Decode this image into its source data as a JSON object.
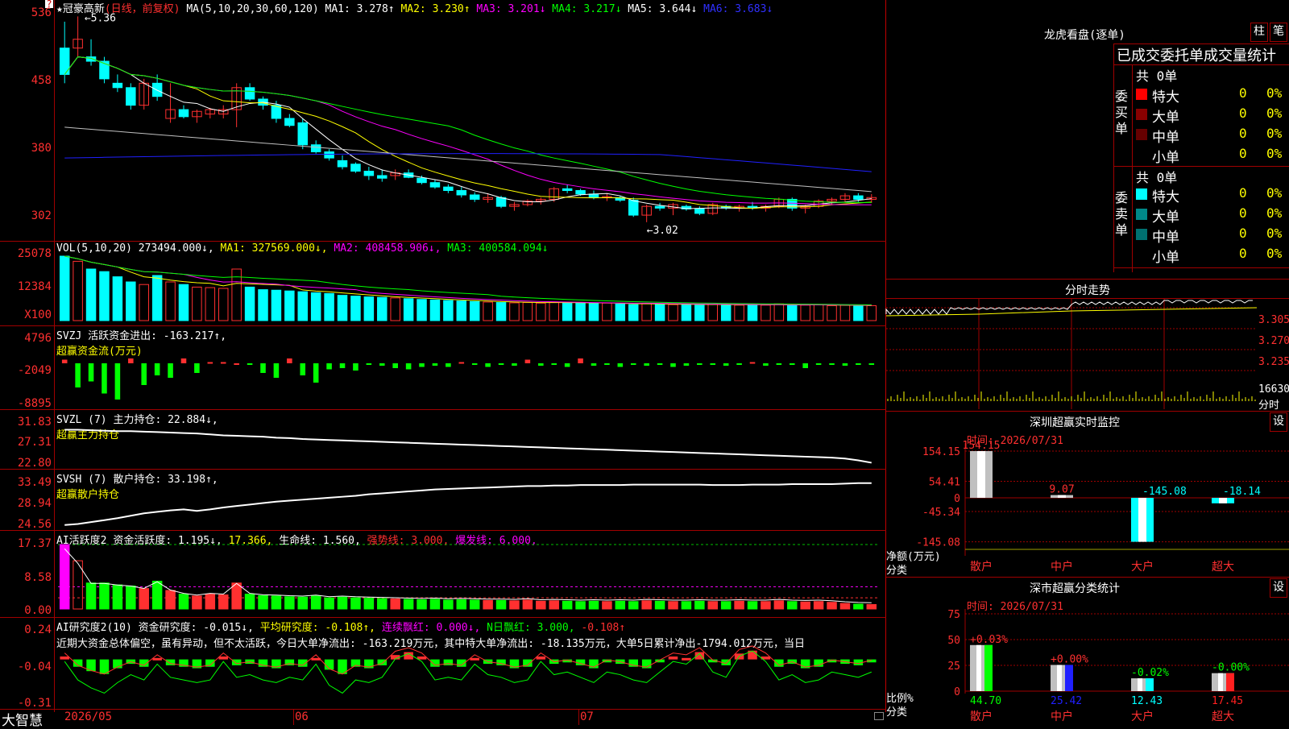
{
  "colors": {
    "up": "#ff3030",
    "down": "#00ffff",
    "bg": "#000000",
    "grid": "#a00000",
    "ma1": "#ffffff",
    "ma2": "#ffff00",
    "ma3": "#ff00ff",
    "ma4": "#00ff00",
    "ma5": "#c0c0c0",
    "ma6": "#2020ff"
  },
  "stock": {
    "star": "★",
    "name": "冠豪高新",
    "mode": "(日线，前复权)",
    "ma_label": "MA(5,10,20,30,60,120)",
    "ma1": "MA1: 3.278↑",
    "ma2": "MA2: 3.230↑",
    "ma3": "MA3: 3.201↓",
    "ma4": "MA4: 3.217↓",
    "ma5": "MA5: 3.644↓",
    "ma6": "MA6: 3.683↓",
    "hi_mark": "5.36",
    "lo_mark": "3.02",
    "corner": "?"
  },
  "y_axis": {
    "price": [
      "536",
      "458",
      "380",
      "302"
    ],
    "vol": [
      "25078",
      "12384",
      "X100"
    ],
    "svzj": [
      "4796",
      "-2049",
      "-8895"
    ],
    "svzl": [
      "31.83",
      "27.31",
      "22.80"
    ],
    "svsh": [
      "33.49",
      "28.94",
      "24.56"
    ],
    "ai1": [
      "17.37",
      "8.58",
      "0.00"
    ],
    "ai2": [
      "0.24",
      "-0.04",
      "-0.31"
    ]
  },
  "panels": {
    "vol": {
      "label": "VOL(5,10,20)",
      "v0": "273494.000↓,",
      "ma1": "MA1: 327569.000↓,",
      "ma2": "MA2: 408458.906↓,",
      "ma3": "MA3: 400584.094↓"
    },
    "svzj": {
      "label": "SVZJ",
      "text": "活跃资金进出: -163.217↑,",
      "sub": "超赢资金流(万元)"
    },
    "svzl": {
      "label": "SVZL (7)",
      "text": "主力持仓: 22.884↓,",
      "sub": "超赢主力持仓"
    },
    "svsh": {
      "label": "SVSH (7)",
      "text": "散户持仓: 33.198↑,",
      "sub": "超赢散户持仓"
    },
    "ai1": {
      "label": "AI活跃度2",
      "t1": "资金活跃度: 1.195↓,",
      "t2": "17.366,",
      "t3": "生命线: 1.560,",
      "t4": "强势线: 3.000,",
      "t5": "爆发线: 6.000,"
    },
    "ai2": {
      "label": "AI研究度2(10)",
      "t1": "资金研究度: -0.015↓,",
      "t2": "平均研究度: -0.108↑,",
      "t3": "连续飘红: 0.000↓,",
      "t4": "N日飘红: 3.000,",
      "t5": "-0.108↑",
      "news": "近期大资金总体偏空，虽有异动，但不太活跃，今日大单净流出: -163.219万元，其中特大单净流出: -18.135万元，大单5日累计净出-1794.012万元，当日"
    }
  },
  "x_axis": {
    "brand": "大智慧",
    "d1": "2026/05",
    "d2": "06",
    "d3": "07"
  },
  "chart_data": [
    {
      "type": "candlestick",
      "title": "冠豪高新 (日线，前复权)",
      "ylim": [
        3.02,
        5.36
      ],
      "hi": 5.36,
      "lo": 3.02,
      "ohlc": [
        [
          5.0,
          5.3,
          4.6,
          4.7
        ],
        [
          5.0,
          5.36,
          4.9,
          5.1
        ],
        [
          4.9,
          5.1,
          4.8,
          4.85
        ],
        [
          4.85,
          4.9,
          4.6,
          4.65
        ],
        [
          4.6,
          4.7,
          4.5,
          4.55
        ],
        [
          4.55,
          4.6,
          4.3,
          4.35
        ],
        [
          4.35,
          4.65,
          4.3,
          4.6
        ],
        [
          4.6,
          4.7,
          4.4,
          4.45
        ],
        [
          4.2,
          4.6,
          4.15,
          4.3
        ],
        [
          4.3,
          4.35,
          4.2,
          4.22
        ],
        [
          4.22,
          4.3,
          4.15,
          4.28
        ],
        [
          4.25,
          4.32,
          4.2,
          4.3
        ],
        [
          4.25,
          4.35,
          4.2,
          4.3
        ],
        [
          4.3,
          4.6,
          4.1,
          4.55
        ],
        [
          4.55,
          4.6,
          4.4,
          4.42
        ],
        [
          4.42,
          4.45,
          4.3,
          4.35
        ],
        [
          4.35,
          4.4,
          4.15,
          4.2
        ],
        [
          4.2,
          4.25,
          4.1,
          4.12
        ],
        [
          4.15,
          4.2,
          3.85,
          3.9
        ],
        [
          3.9,
          3.95,
          3.8,
          3.82
        ],
        [
          3.82,
          3.85,
          3.72,
          3.75
        ],
        [
          3.72,
          3.78,
          3.62,
          3.65
        ],
        [
          3.68,
          3.7,
          3.58,
          3.6
        ],
        [
          3.6,
          3.65,
          3.5,
          3.55
        ],
        [
          3.55,
          3.62,
          3.48,
          3.52
        ],
        [
          3.55,
          3.62,
          3.5,
          3.58
        ],
        [
          3.58,
          3.62,
          3.52,
          3.53
        ],
        [
          3.52,
          3.55,
          3.45,
          3.47
        ],
        [
          3.47,
          3.5,
          3.4,
          3.42
        ],
        [
          3.42,
          3.45,
          3.35,
          3.38
        ],
        [
          3.38,
          3.42,
          3.3,
          3.33
        ],
        [
          3.33,
          3.36,
          3.25,
          3.28
        ],
        [
          3.28,
          3.35,
          3.24,
          3.3
        ],
        [
          3.3,
          3.32,
          3.18,
          3.2
        ],
        [
          3.2,
          3.25,
          3.15,
          3.22
        ],
        [
          3.22,
          3.28,
          3.2,
          3.26
        ],
        [
          3.26,
          3.3,
          3.22,
          3.28
        ],
        [
          3.28,
          3.42,
          3.25,
          3.4
        ],
        [
          3.4,
          3.45,
          3.35,
          3.38
        ],
        [
          3.38,
          3.4,
          3.32,
          3.34
        ],
        [
          3.34,
          3.38,
          3.28,
          3.3
        ],
        [
          3.3,
          3.35,
          3.26,
          3.31
        ],
        [
          3.3,
          3.32,
          3.25,
          3.27
        ],
        [
          3.27,
          3.3,
          3.08,
          3.1
        ],
        [
          3.1,
          3.22,
          3.02,
          3.2
        ],
        [
          3.2,
          3.24,
          3.15,
          3.18
        ],
        [
          3.18,
          3.24,
          3.1,
          3.22
        ],
        [
          3.2,
          3.22,
          3.15,
          3.17
        ],
        [
          3.17,
          3.2,
          3.1,
          3.12
        ],
        [
          3.12,
          3.24,
          3.1,
          3.22
        ],
        [
          3.2,
          3.22,
          3.16,
          3.18
        ],
        [
          3.18,
          3.22,
          3.14,
          3.2
        ],
        [
          3.2,
          3.25,
          3.16,
          3.18
        ],
        [
          3.18,
          3.22,
          3.14,
          3.2
        ],
        [
          3.2,
          3.3,
          3.18,
          3.28
        ],
        [
          3.28,
          3.3,
          3.15,
          3.18
        ],
        [
          3.18,
          3.22,
          3.12,
          3.2
        ],
        [
          3.2,
          3.28,
          3.18,
          3.26
        ],
        [
          3.26,
          3.3,
          3.22,
          3.28
        ],
        [
          3.28,
          3.35,
          3.25,
          3.32
        ],
        [
          3.32,
          3.35,
          3.25,
          3.28
        ],
        [
          3.28,
          3.34,
          3.24,
          3.3
        ]
      ]
    },
    {
      "type": "bar",
      "title": "VOL(5,10,20)",
      "values": [
        250,
        230,
        200,
        190,
        170,
        150,
        140,
        175,
        150,
        140,
        130,
        128,
        125,
        200,
        130,
        120,
        118,
        115,
        112,
        108,
        105,
        98,
        95,
        92,
        90,
        88,
        85,
        82,
        80,
        78,
        76,
        74,
        72,
        70,
        69,
        70,
        68,
        72,
        70,
        68,
        66,
        68,
        64,
        62,
        66,
        64,
        62,
        63,
        60,
        64,
        62,
        60,
        62,
        60,
        65,
        58,
        60,
        62,
        58,
        60,
        56,
        58
      ],
      "ylim": [
        0,
        25078
      ]
    },
    {
      "type": "bar",
      "title": "超赢资金流(万元)",
      "values": [
        3,
        -20,
        -15,
        -25,
        -30,
        4,
        -18,
        -10,
        -12,
        4,
        -8,
        1,
        1,
        0,
        -1,
        -8,
        -12,
        4,
        -10,
        -16,
        -5,
        -4,
        -6,
        -1,
        -2,
        -4,
        -5,
        -3,
        -2,
        -3,
        1,
        -1,
        -3,
        -1,
        -2,
        3,
        -2,
        -1,
        -3,
        4,
        -2,
        -1,
        -3,
        -1,
        -2,
        -1,
        -3,
        -2,
        -1,
        -1,
        -2,
        -1,
        1,
        -2,
        -1,
        -1,
        -4,
        -1,
        -1,
        -2,
        -1,
        -1
      ],
      "ylim": [
        -8895,
        4796
      ]
    },
    {
      "type": "line",
      "title": "超赢主力持仓",
      "values": [
        30,
        30,
        29.9,
        29.8,
        29.7,
        29.7,
        29.6,
        29.5,
        29.4,
        29.3,
        29.2,
        29,
        28.8,
        28.7,
        28.6,
        28.5,
        28.3,
        28.2,
        28,
        27.9,
        27.8,
        27.7,
        27.6,
        27.5,
        27.4,
        27.3,
        27.2,
        27.1,
        27,
        26.9,
        26.8,
        26.7,
        26.6,
        26.5,
        26.4,
        26.3,
        26.2,
        26.1,
        26,
        25.9,
        25.8,
        25.7,
        25.6,
        25.5,
        25.4,
        25.3,
        25.2,
        25.1,
        25,
        24.9,
        24.8,
        24.7,
        24.6,
        24.5,
        24.4,
        24.3,
        24.2,
        24.1,
        24,
        23.8,
        23.4,
        22.9
      ],
      "ylim": [
        22.8,
        31.83
      ]
    },
    {
      "type": "line",
      "title": "超赢散户持仓",
      "values": [
        24.6,
        24.8,
        25.2,
        25.6,
        26,
        26.5,
        27,
        27.3,
        27.6,
        27.8,
        27.5,
        27.8,
        28.2,
        28.5,
        28.8,
        29.1,
        29.4,
        29.6,
        29.8,
        30,
        30.2,
        30.4,
        30.6,
        30.9,
        31.1,
        31.3,
        31.5,
        31.7,
        31.9,
        32,
        32.1,
        32.2,
        32.3,
        32.4,
        32.5,
        32.6,
        32.6,
        32.7,
        32.7,
        32.8,
        32.8,
        32.8,
        32.8,
        32.9,
        32.9,
        32.9,
        32.9,
        32.9,
        32.9,
        32.8,
        32.8,
        32.8,
        32.9,
        32.9,
        32.9,
        33,
        33,
        33,
        33,
        33.1,
        33.2,
        33.2
      ],
      "ylim": [
        24.56,
        33.49
      ]
    },
    {
      "type": "bar",
      "title": "AI活跃度2",
      "values": [
        17.37,
        13,
        7,
        7,
        6.5,
        6.2,
        5.5,
        7.5,
        5,
        4,
        3.5,
        4,
        3.8,
        7,
        4,
        3.6,
        3.5,
        3.3,
        3.2,
        3.5,
        3,
        3.2,
        3,
        2.9,
        2.8,
        2.7,
        2.6,
        2.5,
        2.6,
        2.4,
        2.5,
        2.4,
        2.3,
        2.3,
        2.2,
        2.4,
        2.1,
        2.2,
        2.1,
        2,
        2.1,
        2,
        2.1,
        2,
        2.2,
        2.1,
        2,
        2,
        2.1,
        2,
        2,
        2.1,
        2,
        2,
        2.2,
        2,
        1.9,
        2,
        1.8,
        1.5,
        1.3,
        1.2
      ],
      "ylim": [
        0,
        17.37
      ]
    },
    {
      "type": "bar",
      "title": "AI研究度2(10)",
      "values": [
        0.02,
        -0.05,
        -0.08,
        -0.1,
        -0.06,
        -0.03,
        -0.05,
        0.01,
        -0.04,
        -0.05,
        -0.06,
        -0.05,
        0.02,
        -0.04,
        -0.03,
        -0.05,
        -0.06,
        -0.04,
        -0.05,
        0.01,
        -0.07,
        -0.1,
        -0.05,
        -0.06,
        -0.04,
        0.03,
        0.05,
        0.02,
        -0.05,
        -0.04,
        -0.05,
        0.01,
        -0.03,
        -0.04,
        -0.06,
        -0.05,
        0.02,
        -0.03,
        -0.02,
        -0.04,
        -0.06,
        -0.02,
        -0.03,
        -0.05,
        -0.06,
        -0.02,
        0.02,
        0.01,
        0.05,
        -0.02,
        -0.04,
        0.04,
        0.06,
        0.02,
        -0.05,
        -0.03,
        -0.06,
        -0.05,
        -0.02,
        -0.03,
        -0.04,
        -0.02
      ],
      "ylim": [
        -0.31,
        0.24
      ]
    }
  ],
  "right": {
    "lhb_title": "龙虎看盘(逐单)",
    "btn_zhu": "柱",
    "btn_bi": "笔",
    "lhb_header": "已成交委托单成交量统计",
    "buy_label": "委买单",
    "sell_label": "委卖单",
    "total_buy": "共 0单",
    "total_sell": "共 0单",
    "rows_buy": [
      {
        "name": "特大",
        "n": "0",
        "p": "0%",
        "color": "#ff0000"
      },
      {
        "name": "大单",
        "n": "0",
        "p": "0%",
        "color": "#880000"
      },
      {
        "name": "中单",
        "n": "0",
        "p": "0%",
        "color": "#660000"
      },
      {
        "name": "小单",
        "n": "0",
        "p": "0%",
        "color": "#000000"
      }
    ],
    "rows_sell": [
      {
        "name": "特大",
        "n": "0",
        "p": "0%",
        "color": "#00ffff"
      },
      {
        "name": "大单",
        "n": "0",
        "p": "0%",
        "color": "#008888"
      },
      {
        "name": "中单",
        "n": "0",
        "p": "0%",
        "color": "#007070"
      },
      {
        "name": "小单",
        "n": "0",
        "p": "0%",
        "color": "#000000"
      }
    ],
    "fs_title": "分时走势",
    "fs_y": [
      "3.305",
      "3.270",
      "3.235"
    ],
    "fs_vol": "16630",
    "fs_label": "分时",
    "sz_title": "深圳超赢实时监控",
    "btn_set": "设",
    "time1": "时间: 2026/07/31",
    "sz_y": [
      "154.15",
      "54.41",
      "0",
      "-45.34",
      "-145.08"
    ],
    "sz_ylabel": "净额(万元)",
    "sz_xlabel": "分类",
    "sz_bars": [
      {
        "cat": "散户",
        "v": 154.15,
        "label": "154.15"
      },
      {
        "cat": "中户",
        "v": 9.07,
        "label": "9.07"
      },
      {
        "cat": "大户",
        "v": -145.08,
        "label": "-145.08"
      },
      {
        "cat": "超大",
        "v": -18.14,
        "label": "-18.14"
      }
    ],
    "cls_title": "深市超赢分类统计",
    "time2": "时间: 2026/07/31",
    "cls_y": [
      "75",
      "50",
      "25",
      "0"
    ],
    "cls_ylabel": "比例%",
    "cls_xlabel": "分类",
    "cls_bars": [
      {
        "cat": "散户",
        "v": 44.7,
        "label": "44.70",
        "delta": "+0.03%",
        "color": "#00ff00"
      },
      {
        "cat": "中户",
        "v": 25.42,
        "label": "25.42",
        "delta": "+0.00%",
        "color": "#2020ff"
      },
      {
        "cat": "大户",
        "v": 12.43,
        "label": "12.43",
        "delta": "-0.02%",
        "color": "#00ffff"
      },
      {
        "cat": "超大",
        "v": 17.45,
        "label": "17.45",
        "delta": "-0.00%",
        "color": "#ff2020"
      }
    ]
  }
}
